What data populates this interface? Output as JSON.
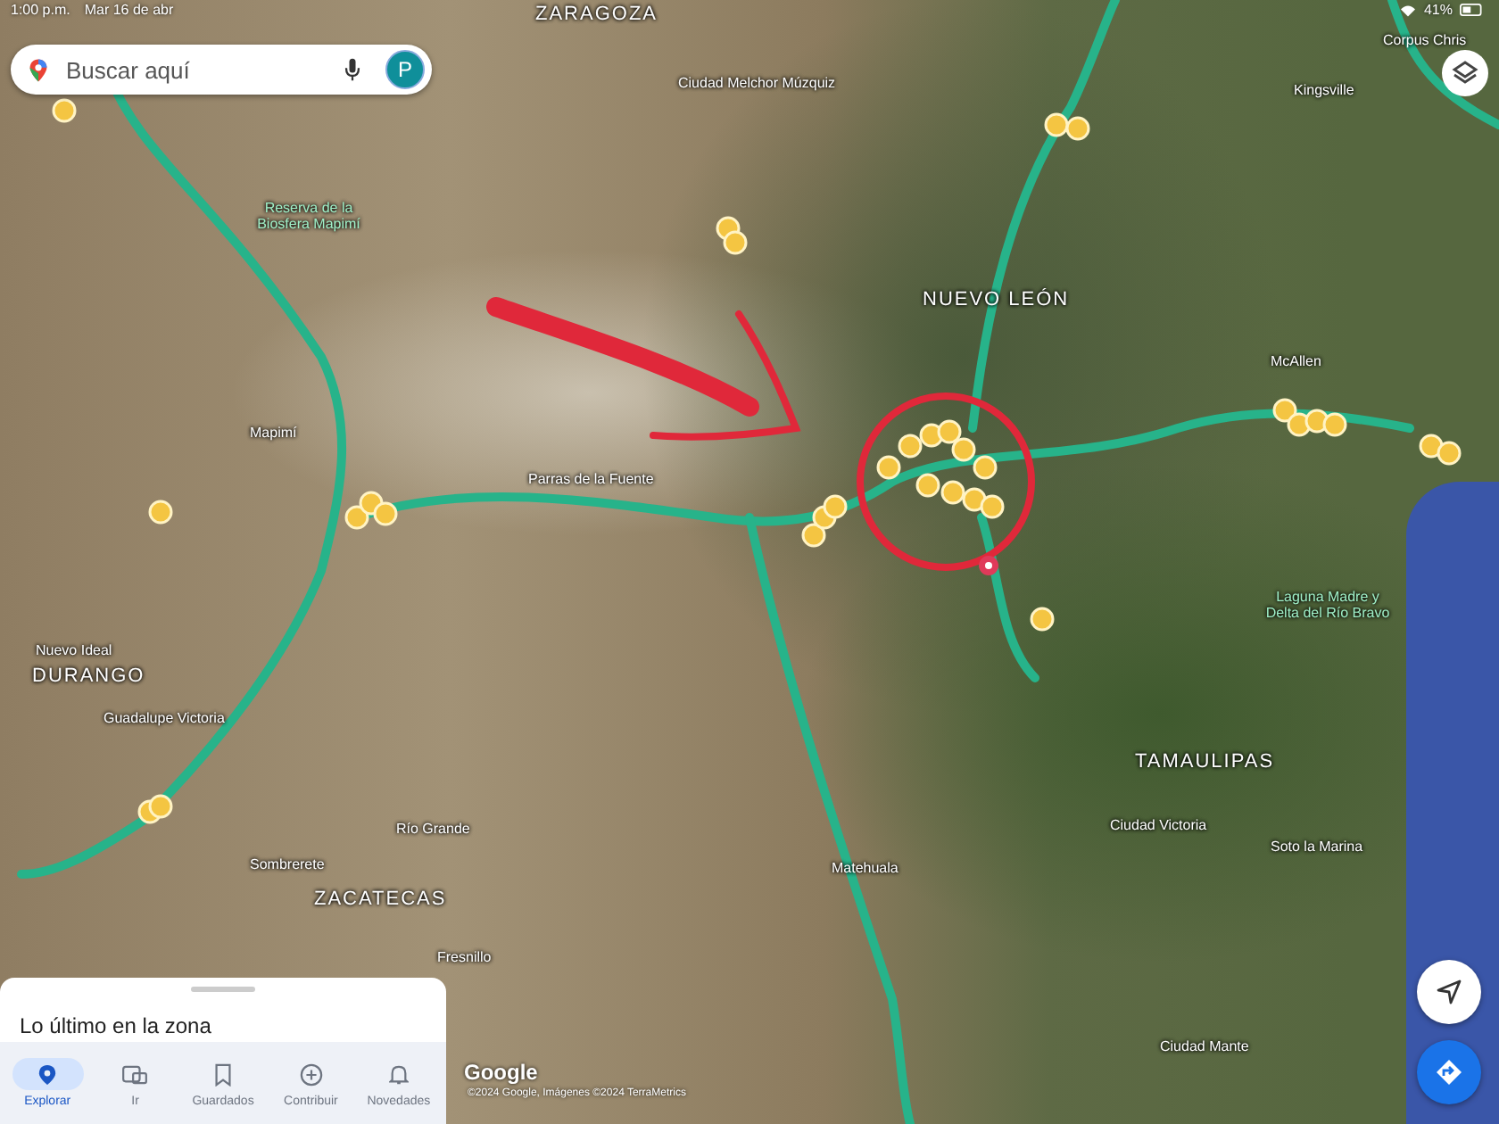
{
  "status_bar": {
    "time": "1:00 p.m.",
    "date": "Mar 16 de abr",
    "battery": "41%"
  },
  "search": {
    "placeholder": "Buscar aquí",
    "avatar": "P"
  },
  "map": {
    "labels": [
      {
        "text": "ZARAGOZA",
        "kind": "state"
      },
      {
        "text": "Corpus Chris",
        "kind": "city"
      },
      {
        "text": "Ciudad Melchor Múzquiz",
        "kind": "city"
      },
      {
        "text": "Kingsville",
        "kind": "city"
      },
      {
        "text": "Reserva de la Biosfera Mapimí",
        "kind": "park"
      },
      {
        "text": "NUEVO LEÓN",
        "kind": "state"
      },
      {
        "text": "McAllen",
        "kind": "city"
      },
      {
        "text": "Mapimí",
        "kind": "city"
      },
      {
        "text": "Parras de la Fuente",
        "kind": "city"
      },
      {
        "text": "Laguna Madre y Delta del Río Bravo",
        "kind": "park"
      },
      {
        "text": "Nuevo Ideal",
        "kind": "city"
      },
      {
        "text": "DURANGO",
        "kind": "state"
      },
      {
        "text": "Guadalupe Victoria",
        "kind": "city"
      },
      {
        "text": "TAMAULIPAS",
        "kind": "state"
      },
      {
        "text": "Ciudad Victoria",
        "kind": "city"
      },
      {
        "text": "Río Grande",
        "kind": "city"
      },
      {
        "text": "Soto la Marina",
        "kind": "city"
      },
      {
        "text": "Sombrerete",
        "kind": "city"
      },
      {
        "text": "Matehuala",
        "kind": "city"
      },
      {
        "text": "ZACATECAS",
        "kind": "state"
      },
      {
        "text": "Fresnillo",
        "kind": "city"
      },
      {
        "text": "Ciudad Mante",
        "kind": "city"
      }
    ]
  },
  "attribution": {
    "logo": "Google",
    "text": "©2024 Google, Imágenes ©2024 TerraMetrics"
  },
  "bottom_sheet": {
    "title": "Lo último en la zona"
  },
  "nav": [
    {
      "label": "Explorar",
      "selected": true
    },
    {
      "label": "Ir",
      "selected": false
    },
    {
      "label": "Guardados",
      "selected": false
    },
    {
      "label": "Contribuir",
      "selected": false
    },
    {
      "label": "Novedades",
      "selected": false
    }
  ]
}
